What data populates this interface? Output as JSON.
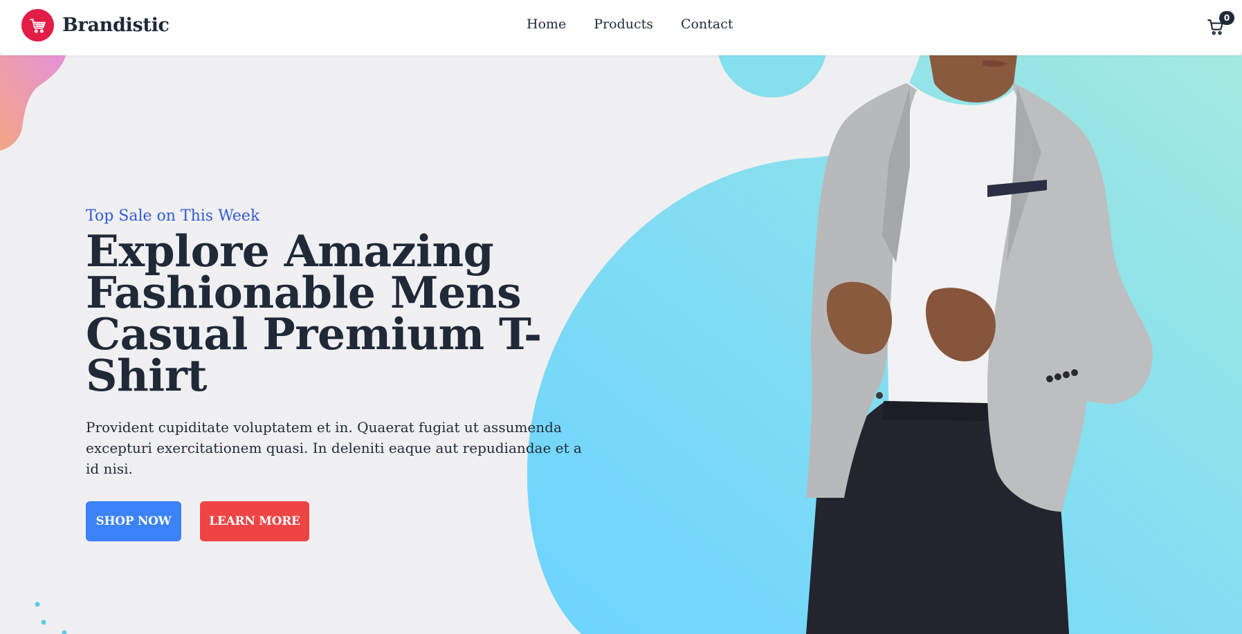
{
  "brand": {
    "name": "Brandistic"
  },
  "nav": {
    "links": [
      "Home",
      "Products",
      "Contact"
    ]
  },
  "cart": {
    "count": "0"
  },
  "hero": {
    "tagline": "Top Sale on This Week",
    "headline": [
      "Explore Amazing",
      "Fashionable Mens",
      "Casual Premium T-Shirt"
    ],
    "description": "Provident cupiditate voluptatem et in. Quaerat fugiat ut assumenda excepturi exercitationem quasi. In deleniti eaque aut repudiandae et a id nisi.",
    "buttons": {
      "shop_now": "SHOP NOW",
      "learn_more": "LEARN MORE"
    }
  },
  "colors": {
    "brand_red": "#e11d48",
    "shop_button": "#3b82f6",
    "learn_button": "#ef4444",
    "tagline_blue": "#2f5bd3",
    "page_background": "#f0eff1",
    "circle_cyan": "#6fd6f5"
  },
  "icons": {
    "brand": "shopping-cart-icon",
    "cart": "shopping-cart-icon"
  }
}
